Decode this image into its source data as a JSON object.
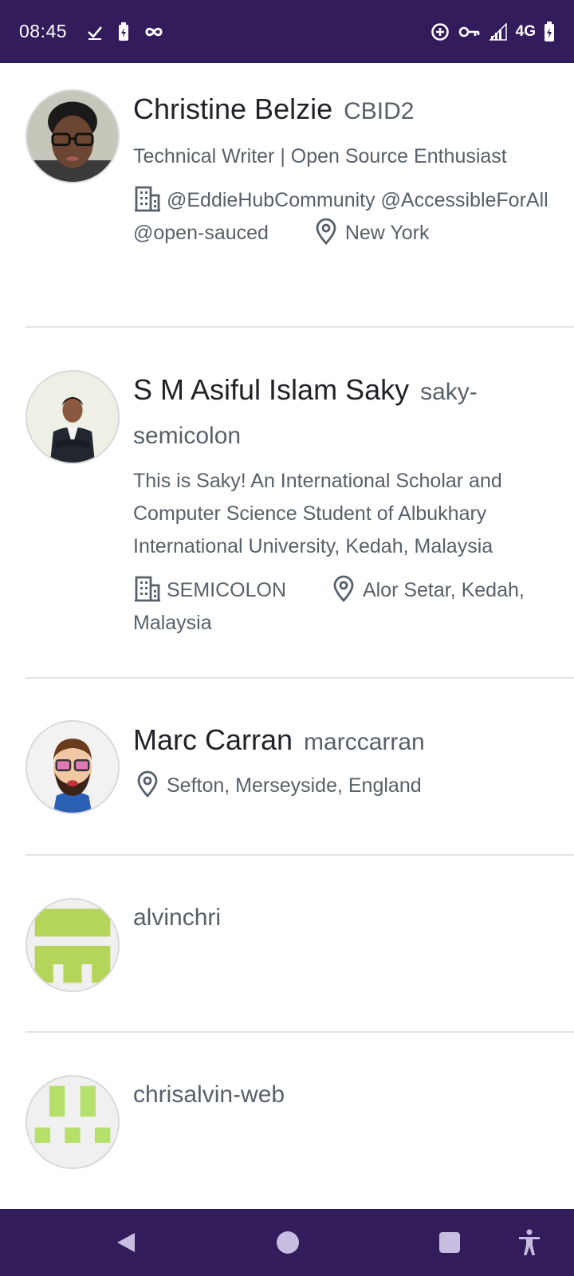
{
  "status_bar": {
    "time": "08:45",
    "network": "4G",
    "icons": [
      "check-icon",
      "battery-saver-icon",
      "infinity-icon",
      "data-saver-icon",
      "vpn-key-icon",
      "signal-icon",
      "battery-charging-icon"
    ]
  },
  "users": [
    {
      "name": "Christine Belzie",
      "login": "CBID2",
      "bio": "Technical Writer | Open Source Enthusiast",
      "company": "@EddieHubCommunity @AccessibleForAll @open-sauced",
      "location": "New York"
    },
    {
      "name": "S M Asiful Islam Saky",
      "login": "saky-semicolon",
      "bio": "This is Saky! An International Scholar and Computer Science Student of Albukhary International University, Kedah, Malaysia",
      "company": "SEMICOLON",
      "location": "Alor Setar, Kedah, Malaysia"
    },
    {
      "name": "Marc Carran",
      "login": "marccarran",
      "location": "Sefton, Merseyside, England"
    },
    {
      "login": "alvinchri",
      "avatar_color": "#b5d45a"
    },
    {
      "login": "chrisalvin-web",
      "avatar_color": "#b5e06a"
    }
  ],
  "colors": {
    "system_bar": "#331c5c",
    "text_primary": "#1f2328",
    "text_secondary": "#57606a",
    "divider": "#e3e4e8"
  },
  "nav_bar": {
    "icons": [
      "back-icon",
      "home-icon",
      "recents-icon",
      "accessibility-icon"
    ]
  }
}
